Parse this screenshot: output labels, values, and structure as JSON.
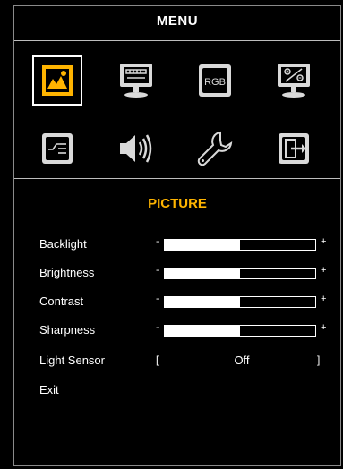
{
  "menu": {
    "title": "MENU"
  },
  "icons": [
    {
      "name": "picture-icon",
      "selected": true,
      "label": ""
    },
    {
      "name": "display-position-icon",
      "selected": false,
      "label": ""
    },
    {
      "name": "rgb-icon",
      "selected": false,
      "label": "RGB"
    },
    {
      "name": "percent-icon",
      "selected": false,
      "label": ""
    },
    {
      "name": "input-switch-icon",
      "selected": false,
      "label": ""
    },
    {
      "name": "audio-speaker-icon",
      "selected": false,
      "label": ""
    },
    {
      "name": "settings-wrench-icon",
      "selected": false,
      "label": ""
    },
    {
      "name": "exit-icon",
      "selected": false,
      "label": ""
    }
  ],
  "section": {
    "title": "PICTURE"
  },
  "settings": {
    "backlight": {
      "label": "Backlight",
      "fraction": 0.5,
      "minus": "-",
      "plus": "+"
    },
    "brightness": {
      "label": "Brightness",
      "fraction": 0.5,
      "minus": "-",
      "plus": "+"
    },
    "contrast": {
      "label": "Contrast",
      "fraction": 0.5,
      "minus": "-",
      "plus": "+"
    },
    "sharpness": {
      "label": "Sharpness",
      "fraction": 0.5,
      "minus": "-",
      "plus": "+"
    },
    "light_sensor": {
      "label": "Light Sensor",
      "value": "Off",
      "bracket_left": "[",
      "bracket_right": "]"
    },
    "exit": {
      "label": "Exit"
    }
  },
  "colors": {
    "accent": "#ffb400",
    "icon_bg": "#d9d9d9",
    "frame_border": "#8a8a8a"
  }
}
